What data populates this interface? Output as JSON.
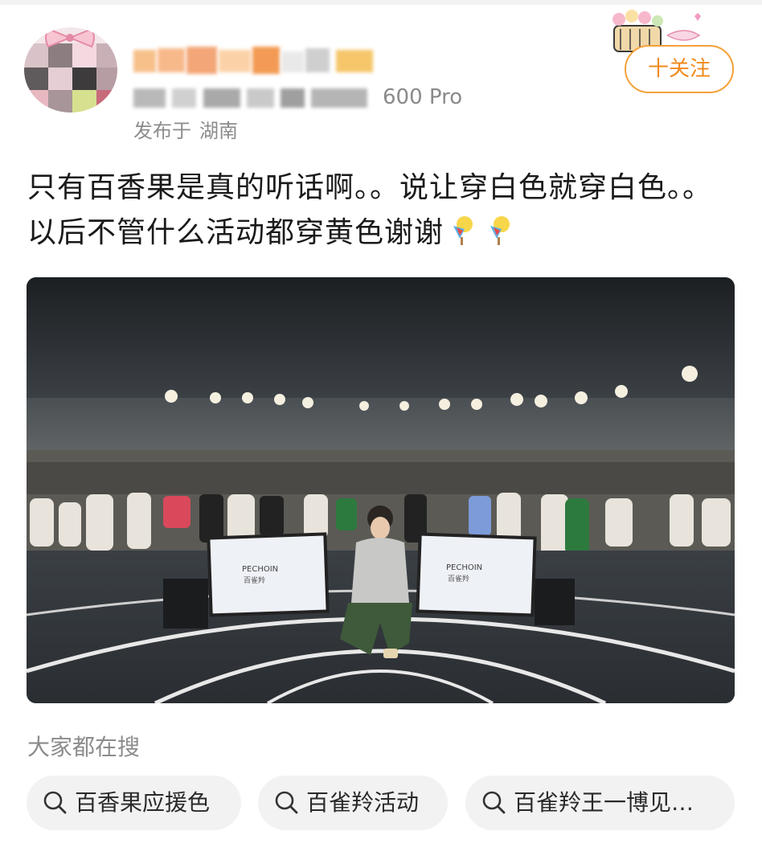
{
  "post": {
    "device_suffix": "600 Pro",
    "published_label": "发布于",
    "location": "湖南",
    "follow_label": "十关注",
    "text": "只有百香果是真的听话啊。。说让穿白色就穿白色。。以后不管什么活动都穿黄色谢谢",
    "emoji": [
      "popsicle-icon",
      "popsicle-icon"
    ]
  },
  "photo": {
    "screen_brand": "PECHOIN",
    "screen_sub": "百雀羚"
  },
  "search": {
    "title": "大家都在搜",
    "chips": [
      {
        "label": "百香果应援色"
      },
      {
        "label": "百雀羚活动"
      },
      {
        "label": "百雀羚王一博见…"
      }
    ]
  },
  "colors": {
    "accent": "#f08a1c",
    "follow_border": "#f4a23a",
    "chip_bg": "#f2f2f2",
    "muted_text": "#8c8c8c"
  }
}
